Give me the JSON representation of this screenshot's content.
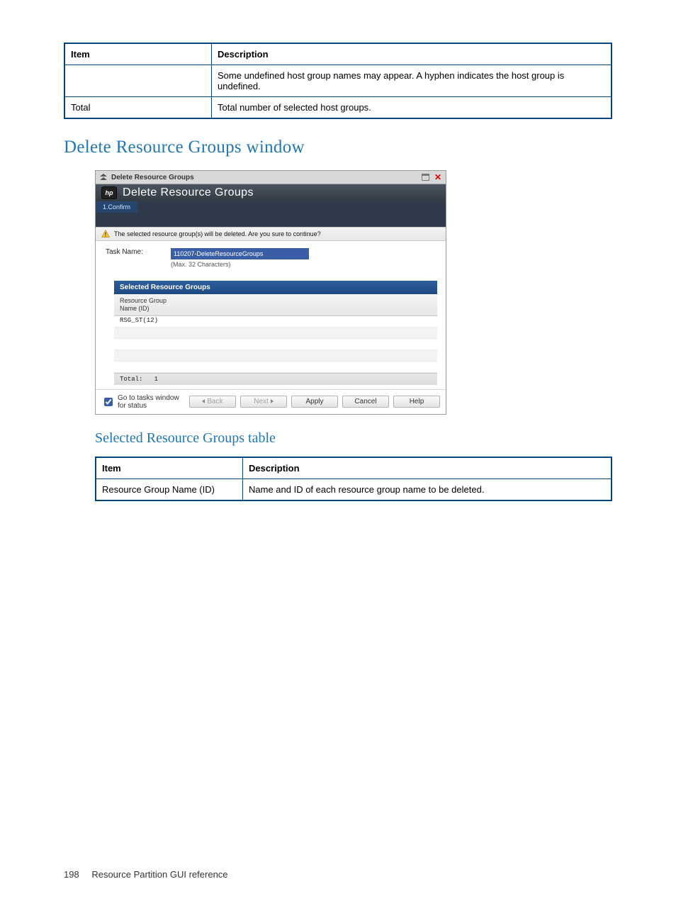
{
  "top_table": {
    "headers": {
      "item": "Item",
      "description": "Description"
    },
    "rows": [
      {
        "item": "",
        "description": "Some undefined host group names may appear. A hyphen indicates the host group is undefined."
      },
      {
        "item": "Total",
        "description": "Total number of selected host groups."
      }
    ]
  },
  "heading1": "Delete Resource Groups window",
  "heading2": "Selected Resource Groups table",
  "ui": {
    "titlebar": "Delete Resource Groups",
    "brand_title": "Delete Resource Groups",
    "step_label": "1.Confirm",
    "warning": "The selected resource group(s) will be deleted. Are you sure to continue?",
    "task_name_label": "Task Name:",
    "task_name_value": "110207-DeleteResourceGroups",
    "task_name_hint": "(Max. 32 Characters)",
    "srg": {
      "header": "Selected Resource Groups",
      "column_label": "Resource Group\nName (ID)",
      "rows": [
        "RSG_ST(12)",
        "",
        "",
        "",
        ""
      ],
      "total_label": "Total:",
      "total_value": "1"
    },
    "actionbar": {
      "goto_tasks_label": "Go to tasks window for status",
      "goto_tasks_checked": true,
      "back": "Back",
      "next": "Next",
      "apply": "Apply",
      "cancel": "Cancel",
      "help": "Help"
    }
  },
  "srg_desc_table": {
    "headers": {
      "item": "Item",
      "description": "Description"
    },
    "rows": [
      {
        "item": "Resource Group Name (ID)",
        "description": "Name and ID of each resource group name to be deleted."
      }
    ]
  },
  "footer": {
    "page_number": "198",
    "section": "Resource Partition GUI reference"
  }
}
